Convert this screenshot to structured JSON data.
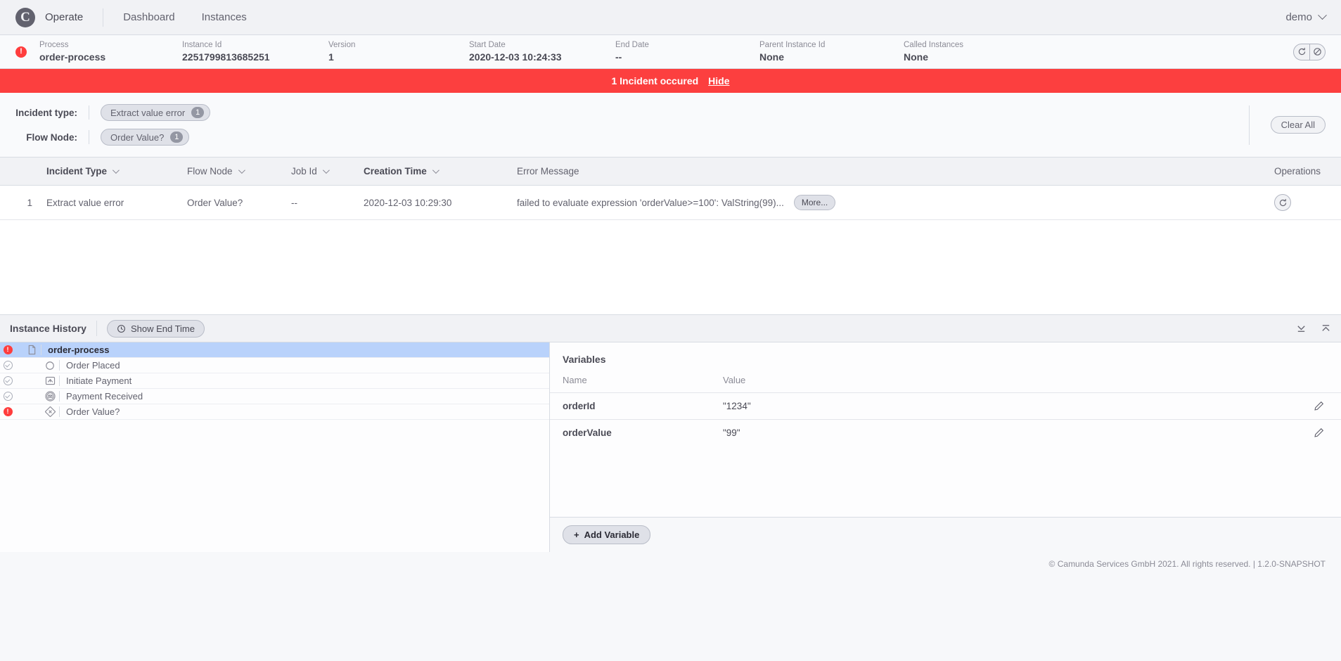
{
  "topnav": {
    "logo_glyph": "C",
    "brand": "Operate",
    "links": [
      {
        "label": "Dashboard"
      },
      {
        "label": "Instances"
      }
    ],
    "user": "demo"
  },
  "instance_header": {
    "status_icon": "error-exclamation-icon",
    "fields": [
      {
        "label": "Process",
        "value": "order-process"
      },
      {
        "label": "Instance Id",
        "value": "2251799813685251"
      },
      {
        "label": "Version",
        "value": "1"
      },
      {
        "label": "Start Date",
        "value": "2020-12-03 10:24:33"
      },
      {
        "label": "End Date",
        "value": "--"
      },
      {
        "label": "Parent Instance Id",
        "value": "None"
      },
      {
        "label": "Called Instances",
        "value": "None"
      }
    ],
    "operations": [
      {
        "name": "retry-instance-button",
        "icon": "retry-icon"
      },
      {
        "name": "cancel-instance-button",
        "icon": "cancel-icon"
      }
    ]
  },
  "banner": {
    "text": "1 Incident occured",
    "hide_label": "Hide",
    "color": "#fc3f3f"
  },
  "filters": {
    "rows": [
      {
        "label": "Incident type:",
        "chips": [
          {
            "label": "Extract value error",
            "count": "1"
          }
        ]
      },
      {
        "label": "Flow Node:",
        "chips": [
          {
            "label": "Order Value?",
            "count": "1"
          }
        ]
      }
    ],
    "clear_all_label": "Clear All"
  },
  "incidents_table": {
    "columns": [
      {
        "label": "Incident Type",
        "sorted": true
      },
      {
        "label": "Flow Node",
        "sorted": false
      },
      {
        "label": "Job Id",
        "sorted": false
      },
      {
        "label": "Creation Time",
        "sorted": true
      },
      {
        "label": "Error Message",
        "sorted": false
      },
      {
        "label": "Operations",
        "sorted": false
      }
    ],
    "rows": [
      {
        "index": "1",
        "incident_type": "Extract value error",
        "flow_node": "Order Value?",
        "job_id": "--",
        "creation_time": "2020-12-03 10:29:30",
        "error_message": "failed to evaluate expression 'orderValue>=100': ValString(99)...",
        "more_label": "More...",
        "operation_icon": "retry-icon"
      }
    ]
  },
  "instance_history": {
    "title": "Instance History",
    "show_end_time_label": "Show End Time",
    "panel_controls": [
      {
        "name": "collapse-panel-button",
        "icon": "collapse-down-icon"
      },
      {
        "name": "expand-panel-button",
        "icon": "expand-up-icon"
      }
    ],
    "tree": [
      {
        "name": "order-process",
        "state": "incident",
        "icon": "process-document-icon",
        "depth": 0,
        "selected": true
      },
      {
        "name": "Order Placed",
        "state": "completed",
        "icon": "start-event-icon",
        "depth": 1,
        "selected": false
      },
      {
        "name": "Initiate Payment",
        "state": "completed",
        "icon": "send-task-icon",
        "depth": 1,
        "selected": false
      },
      {
        "name": "Payment Received",
        "state": "completed",
        "icon": "message-event-icon",
        "depth": 1,
        "selected": false
      },
      {
        "name": "Order Value?",
        "state": "incident",
        "icon": "exclusive-gateway-icon",
        "depth": 1,
        "selected": false
      }
    ]
  },
  "variables": {
    "title": "Variables",
    "col_name": "Name",
    "col_value": "Value",
    "rows": [
      {
        "name": "orderId",
        "value": "\"1234\""
      },
      {
        "name": "orderValue",
        "value": "\"99\""
      }
    ],
    "add_label": "Add Variable",
    "add_plus": "+"
  },
  "footer": {
    "text": "© Camunda Services GmbH 2021. All rights reserved. | 1.2.0-SNAPSHOT"
  }
}
